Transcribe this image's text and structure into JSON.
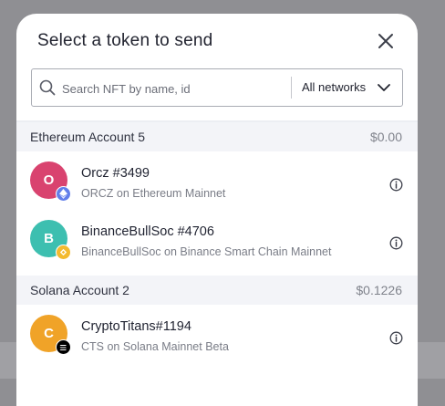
{
  "modal": {
    "title": "Select a token to send"
  },
  "search": {
    "placeholder": "Search NFT by name, id",
    "network_label": "All networks"
  },
  "accounts": [
    {
      "name": "Ethereum Account 5",
      "balance": "$0.00",
      "nfts": [
        {
          "initial": "O",
          "name": "Orcz #3499",
          "subtitle": "ORCZ on Ethereum Mainnet",
          "avatar_color": "#d9436f",
          "network_icon": "ethereum-icon"
        },
        {
          "initial": "B",
          "name": "BinanceBullSoc #4706",
          "subtitle": "BinanceBullSoc on Binance Smart Chain Mainnet",
          "avatar_color": "#3dbfb0",
          "network_icon": "binance-icon"
        }
      ]
    },
    {
      "name": "Solana Account 2",
      "balance": "$0.1226",
      "nfts": [
        {
          "initial": "C",
          "name": "CryptoTitans#1194",
          "subtitle": "CTS on Solana Mainnet Beta",
          "avatar_color": "#f0a328",
          "network_icon": "solana-icon"
        }
      ]
    }
  ]
}
